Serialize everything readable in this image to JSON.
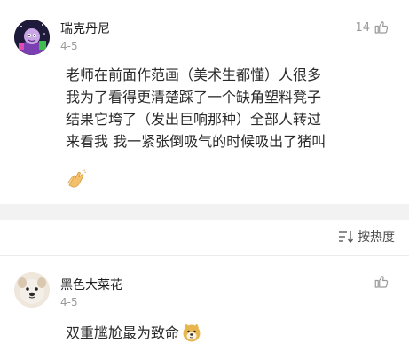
{
  "comments": [
    {
      "username": "瑞克丹尼",
      "date": "4-5",
      "likes": "14",
      "text_lines": [
        "老师在前面作范画（美术生都懂）人很多",
        "我为了看得更清楚踩了一个缺角塑料凳子",
        "结果它垮了（发出巨响那种）全部人转过",
        "来看我 我一紧张倒吸气的时候吸出了猪叫"
      ],
      "trailing_emoji": "clapping-hands-emoji"
    },
    {
      "username": "黑色大菜花",
      "date": "4-5",
      "likes": "",
      "text": "双重尴尬最为致命",
      "trailing_emoji": "doge-emoji"
    }
  ],
  "sort": {
    "label": "按热度"
  },
  "colors": {
    "background": "#ffffff",
    "divider": "#f2f2f2",
    "meta_gray": "#9a9a9a",
    "text": "#2a2a2a"
  }
}
